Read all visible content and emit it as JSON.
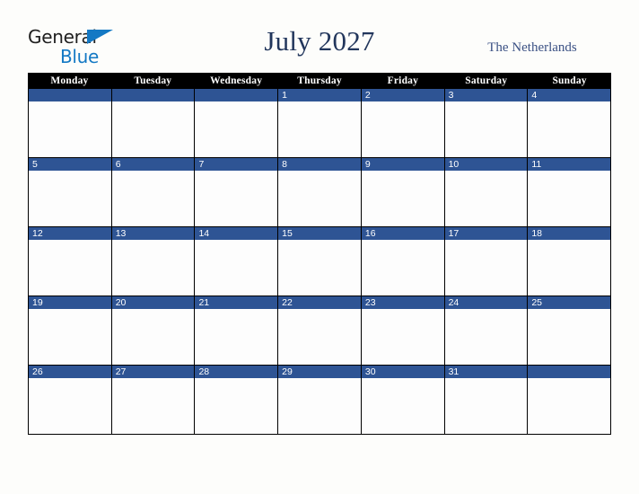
{
  "brand": {
    "name_part_1": "General",
    "name_part_2": "Blue",
    "flag_icon": "triangle-flag-icon",
    "primary_color": "#1479c4",
    "text_color": "#1f1f1f"
  },
  "header": {
    "title": "July 2027",
    "region": "The Netherlands",
    "title_color": "#22365c",
    "region_color": "#3b5184"
  },
  "calendar": {
    "month": "July",
    "year": "2027",
    "weekday_headers": [
      "Monday",
      "Tuesday",
      "Wednesday",
      "Thursday",
      "Friday",
      "Saturday",
      "Sunday"
    ],
    "header_background": "#000000",
    "header_text_color": "#ffffff",
    "date_bar_color": "#2e5494",
    "date_text_color": "#ffffff",
    "cell_background": "#fdfdfd",
    "grid_line_color": "#000000",
    "weeks": [
      [
        {
          "day": "",
          "in_month": false
        },
        {
          "day": "",
          "in_month": false
        },
        {
          "day": "",
          "in_month": false
        },
        {
          "day": "1",
          "in_month": true
        },
        {
          "day": "2",
          "in_month": true
        },
        {
          "day": "3",
          "in_month": true
        },
        {
          "day": "4",
          "in_month": true
        }
      ],
      [
        {
          "day": "5",
          "in_month": true
        },
        {
          "day": "6",
          "in_month": true
        },
        {
          "day": "7",
          "in_month": true
        },
        {
          "day": "8",
          "in_month": true
        },
        {
          "day": "9",
          "in_month": true
        },
        {
          "day": "10",
          "in_month": true
        },
        {
          "day": "11",
          "in_month": true
        }
      ],
      [
        {
          "day": "12",
          "in_month": true
        },
        {
          "day": "13",
          "in_month": true
        },
        {
          "day": "14",
          "in_month": true
        },
        {
          "day": "15",
          "in_month": true
        },
        {
          "day": "16",
          "in_month": true
        },
        {
          "day": "17",
          "in_month": true
        },
        {
          "day": "18",
          "in_month": true
        }
      ],
      [
        {
          "day": "19",
          "in_month": true
        },
        {
          "day": "20",
          "in_month": true
        },
        {
          "day": "21",
          "in_month": true
        },
        {
          "day": "22",
          "in_month": true
        },
        {
          "day": "23",
          "in_month": true
        },
        {
          "day": "24",
          "in_month": true
        },
        {
          "day": "25",
          "in_month": true
        }
      ],
      [
        {
          "day": "26",
          "in_month": true
        },
        {
          "day": "27",
          "in_month": true
        },
        {
          "day": "28",
          "in_month": true
        },
        {
          "day": "29",
          "in_month": true
        },
        {
          "day": "30",
          "in_month": true
        },
        {
          "day": "31",
          "in_month": true
        },
        {
          "day": "",
          "in_month": false
        }
      ]
    ]
  },
  "page": {
    "background": "#fdfdfb"
  }
}
